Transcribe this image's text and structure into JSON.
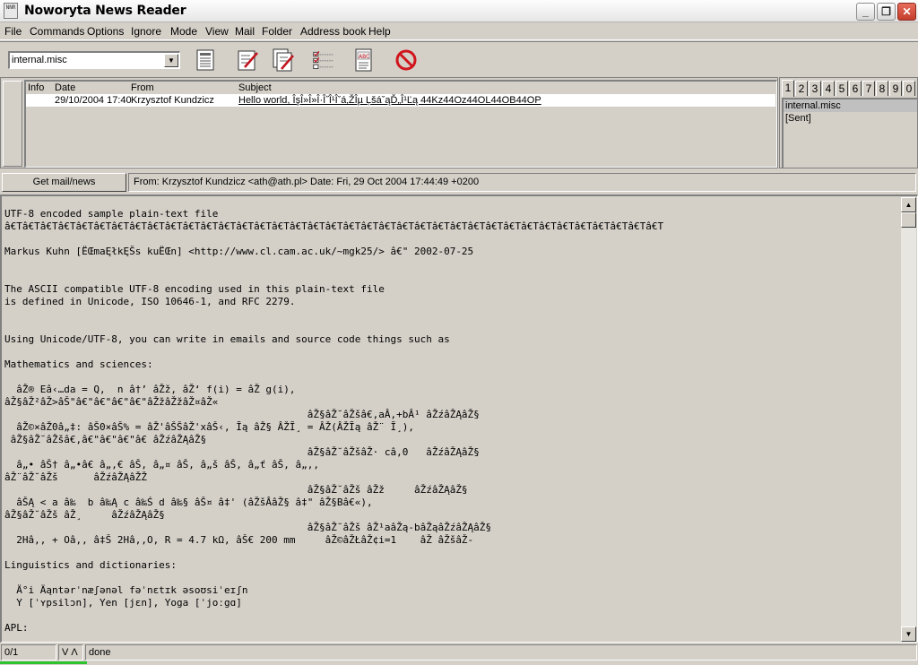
{
  "window": {
    "title": "Noworyta News Reader",
    "icon_label": "NNR"
  },
  "menu": [
    "File",
    "Commands",
    "Options",
    "Ignore",
    "Mode",
    "View",
    "Mail",
    "Folder",
    "Address book",
    "Help"
  ],
  "toolbar": {
    "folder_select_value": "internal.misc",
    "icons": [
      "message-list-icon",
      "compose-icon",
      "reply-icon",
      "checklist-icon",
      "spellcheck-icon",
      "cancel-icon"
    ]
  },
  "message_list": {
    "columns": {
      "info": "Info",
      "date": "Date",
      "from": "From",
      "subject": "Subject"
    },
    "rows": [
      {
        "info": "",
        "date": "29/10/2004 17:40",
        "from": "Krzysztof Kundzicz",
        "subject": "Hello world, ÎşÎ»Î»Î·Î˝Î¹Îˇá‚ŽÎµ ĻšáˇąĎ„Î¹Ľą  44Kz44Oz44OL44OB44OP"
      }
    ]
  },
  "folders": {
    "tabs": [
      "1",
      "2",
      "3",
      "4",
      "5",
      "6",
      "7",
      "8",
      "9",
      "0"
    ],
    "active_tab": "1",
    "items": [
      "internal.misc",
      "[Sent]"
    ]
  },
  "get_mail_label": "Get mail/news",
  "header_line": "From: Krzysztof Kundzicz <ath@ath.pl> Date: Fri, 29 Oct 2004 17:44:49 +0200",
  "body_lines": [
    "UTF-8 encoded sample plain-text file",
    "â€Tâ€Tâ€Tâ€Tâ€Tâ€Tâ€Tâ€Tâ€Tâ€Tâ€Tâ€Tâ€Tâ€Tâ€Tâ€Tâ€Tâ€Tâ€Tâ€Tâ€Tâ€Tâ€Tâ€Tâ€Tâ€Tâ€Tâ€Tâ€Tâ€Tâ€Tâ€Tâ€Tâ€Tâ€Tâ€Tâ€T",
    "",
    "Markus Kuhn [ËŒmaĘłkĘŠs kuËŒn] <http://www.cl.cam.ac.uk/~mgk25/> â€\" 2002-07-25",
    "",
    "",
    "The ASCII compatible UTF-8 encoding used in this plain-text file",
    "is defined in Unicode, ISO 10646-1, and RFC 2279.",
    "",
    "",
    "Using Unicode/UTF-8, you can write in emails and source code things such as",
    "",
    "Mathematics and sciences:",
    "",
    "  âŽ® Eâ‹…da = Q,  n â†’ âŽž, âŽ‘ f(i) = âŽ g(i),",
    "âŽ§âŽ²âŽ>âŠ\"â€\"â€\"â€\"â€\"âŽžâŽžâŽ¤âŽ«",
    "                                                   âŽ§âŽ˘âŽšâ€,aÂ,+bÂ¹ âŽźâŽĄâŽ§",
    "  âŽ©×âŽ0â„‡: âŠ0×âŠ% = âŽ'âŠŠâŽ'xâŠ‹, Ĩą âŽ§ ÂŽĨ¸ = ÂŽ(ÂŽĨą âŽ¨ Ĩ¸),",
    " âŽ§âŽ˘âŽšâ€,â€\"â€\"â€\"â€ âŽźâŽĄâŽ§",
    "                                                   âŽ§âŽ˘âŽšâŽ· câ,0   âŽźâŽĄâŽ§",
    "  â„• âŠ† â„•â€ â„,€ âŠ, â„¤ âŠ, â„š âŠ, â„ť âŠ, â„,,",
    "âŽ¨âŽ˘âŽš      âŽźâŽĄâŽŽ",
    "                                                   âŽ§âŽ˘âŽš âŽž     âŽźâŽĄâŽ§",
    "  âŠĄ < a â‰  b â‰Ą c â‰Ś d â‰§ âŠ¤ â‡' (âŽšÂâŽ§ â‡\" âŽ§Bâ€«),",
    "âŽ§âŽ˘âŽš âŽ¸     âŽźâŽĄâŽ§",
    "                                                   âŽ§âŽ˘âŽš âŽ¹aâŽą-bâŽąâŽźâŽĄâŽ§",
    "  2Hâ,, + Oâ,, â‡Š 2Hâ,,O, R = 4.7 kΩ, âŠ€ 200 mm     âŽ©âŽŁâŽ¢i=1    âŽ âŽšâŽ-",
    "",
    "Linguistics and dictionaries:",
    "",
    "  Ä°i Äąntərˈnæʃənəl fəˈnɛtɪk əsoʊsiˈeɪʃn",
    "  Y [ˈʏpsilɔn], Yen [jɛn], Yoga [ˈjoːgɑ]",
    "",
    "APL:"
  ],
  "status": {
    "position": "0/1",
    "mode": "V Λ",
    "message": "done"
  }
}
